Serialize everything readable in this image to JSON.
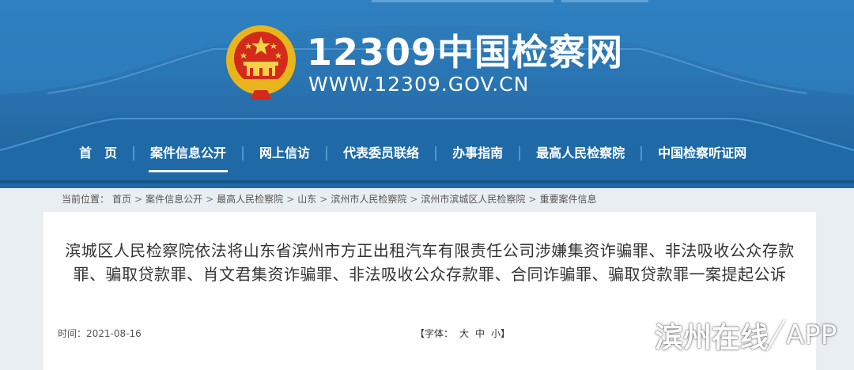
{
  "header": {
    "site_title": "12309中国检察网",
    "site_url": "WWW.12309.GOV.CN",
    "colors": {
      "banner": "#2a75b3",
      "emblem_gold": "#e8b51d",
      "emblem_red": "#d42a1b"
    }
  },
  "nav": {
    "items": [
      {
        "label": "首　页",
        "active": false
      },
      {
        "label": "案件信息公开",
        "active": true
      },
      {
        "label": "网上信访",
        "active": false
      },
      {
        "label": "代表委员联络",
        "active": false
      },
      {
        "label": "办事指南",
        "active": false
      },
      {
        "label": "最高人民检察院",
        "active": false
      },
      {
        "label": "中国检察听证网",
        "active": false
      }
    ]
  },
  "breadcrumb": {
    "prefix": "当前位置：",
    "items": [
      "首页",
      "案件信息公开",
      "最高人民检察院",
      "山东",
      "滨州市人民检察院",
      "滨州市滨城区人民检察院",
      "重要案件信息"
    ],
    "separator": ">"
  },
  "article": {
    "title": "滨城区人民检察院依法将山东省滨州市方正出租汽车有限责任公司涉嫌集资诈骗罪、非法吸收公众存款罪、骗取贷款罪、肖文君集资诈骗罪、非法吸收公众存款罪、合同诈骗罪、骗取贷款罪一案提起公诉",
    "time": "时间：2021-08-16",
    "font_label": "【字体：",
    "font_large": "大",
    "font_medium": "中",
    "font_small": "小】"
  },
  "watermark": {
    "text": "滨州在线",
    "app": "APP"
  }
}
